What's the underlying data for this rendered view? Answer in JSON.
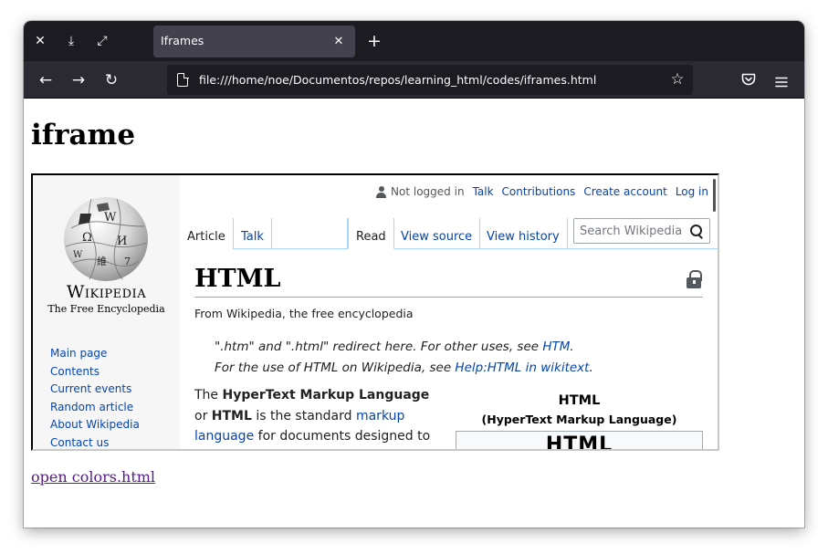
{
  "window_controls": {
    "close": "✕",
    "minimize": "⤓",
    "maximize": "⤢"
  },
  "tab": {
    "title": "Iframes",
    "close": "✕"
  },
  "new_tab": "+",
  "nav": {
    "back": "←",
    "forward": "→",
    "reload": "↻"
  },
  "url": "file:///home/noe/Documentos/repos/learning_html/codes/iframes.html",
  "url_star": "☆",
  "page": {
    "heading": "iframe",
    "link_text": "open colors.html"
  },
  "wikipedia": {
    "wordmark": "Wikipedia",
    "tagline": "The Free Encyclopedia",
    "nav_items": [
      "Main page",
      "Contents",
      "Current events",
      "Random article",
      "About Wikipedia",
      "Contact us"
    ],
    "personal": {
      "not_logged_in": "Not logged in",
      "talk": "Talk",
      "contributions": "Contributions",
      "create_account": "Create account",
      "log_in": "Log in"
    },
    "tabs": {
      "article": "Article",
      "talk": "Talk",
      "read": "Read",
      "view_source": "View source",
      "view_history": "View history"
    },
    "search_placeholder": "Search Wikipedia",
    "title": "HTML",
    "from": "From Wikipedia, the free encyclopedia",
    "hatnote1": {
      "text_a": "\".htm\" and \".html\" redirect here. For other uses, see ",
      "link": "HTM",
      "text_b": "."
    },
    "hatnote2": {
      "text_a": "For the use of HTML on Wikipedia, see ",
      "link": "Help:HTML in wikitext",
      "text_b": "."
    },
    "body": {
      "t1": "The ",
      "b1": "HyperText Markup Language",
      "t2": " or ",
      "b2": "HTML",
      "t3": " is the standard ",
      "link1": "markup language",
      "t4": " for documents designed to"
    },
    "infobox": {
      "title": "HTML",
      "subtitle": "(HyperText Markup Language)",
      "logo_text": "HTML"
    }
  }
}
